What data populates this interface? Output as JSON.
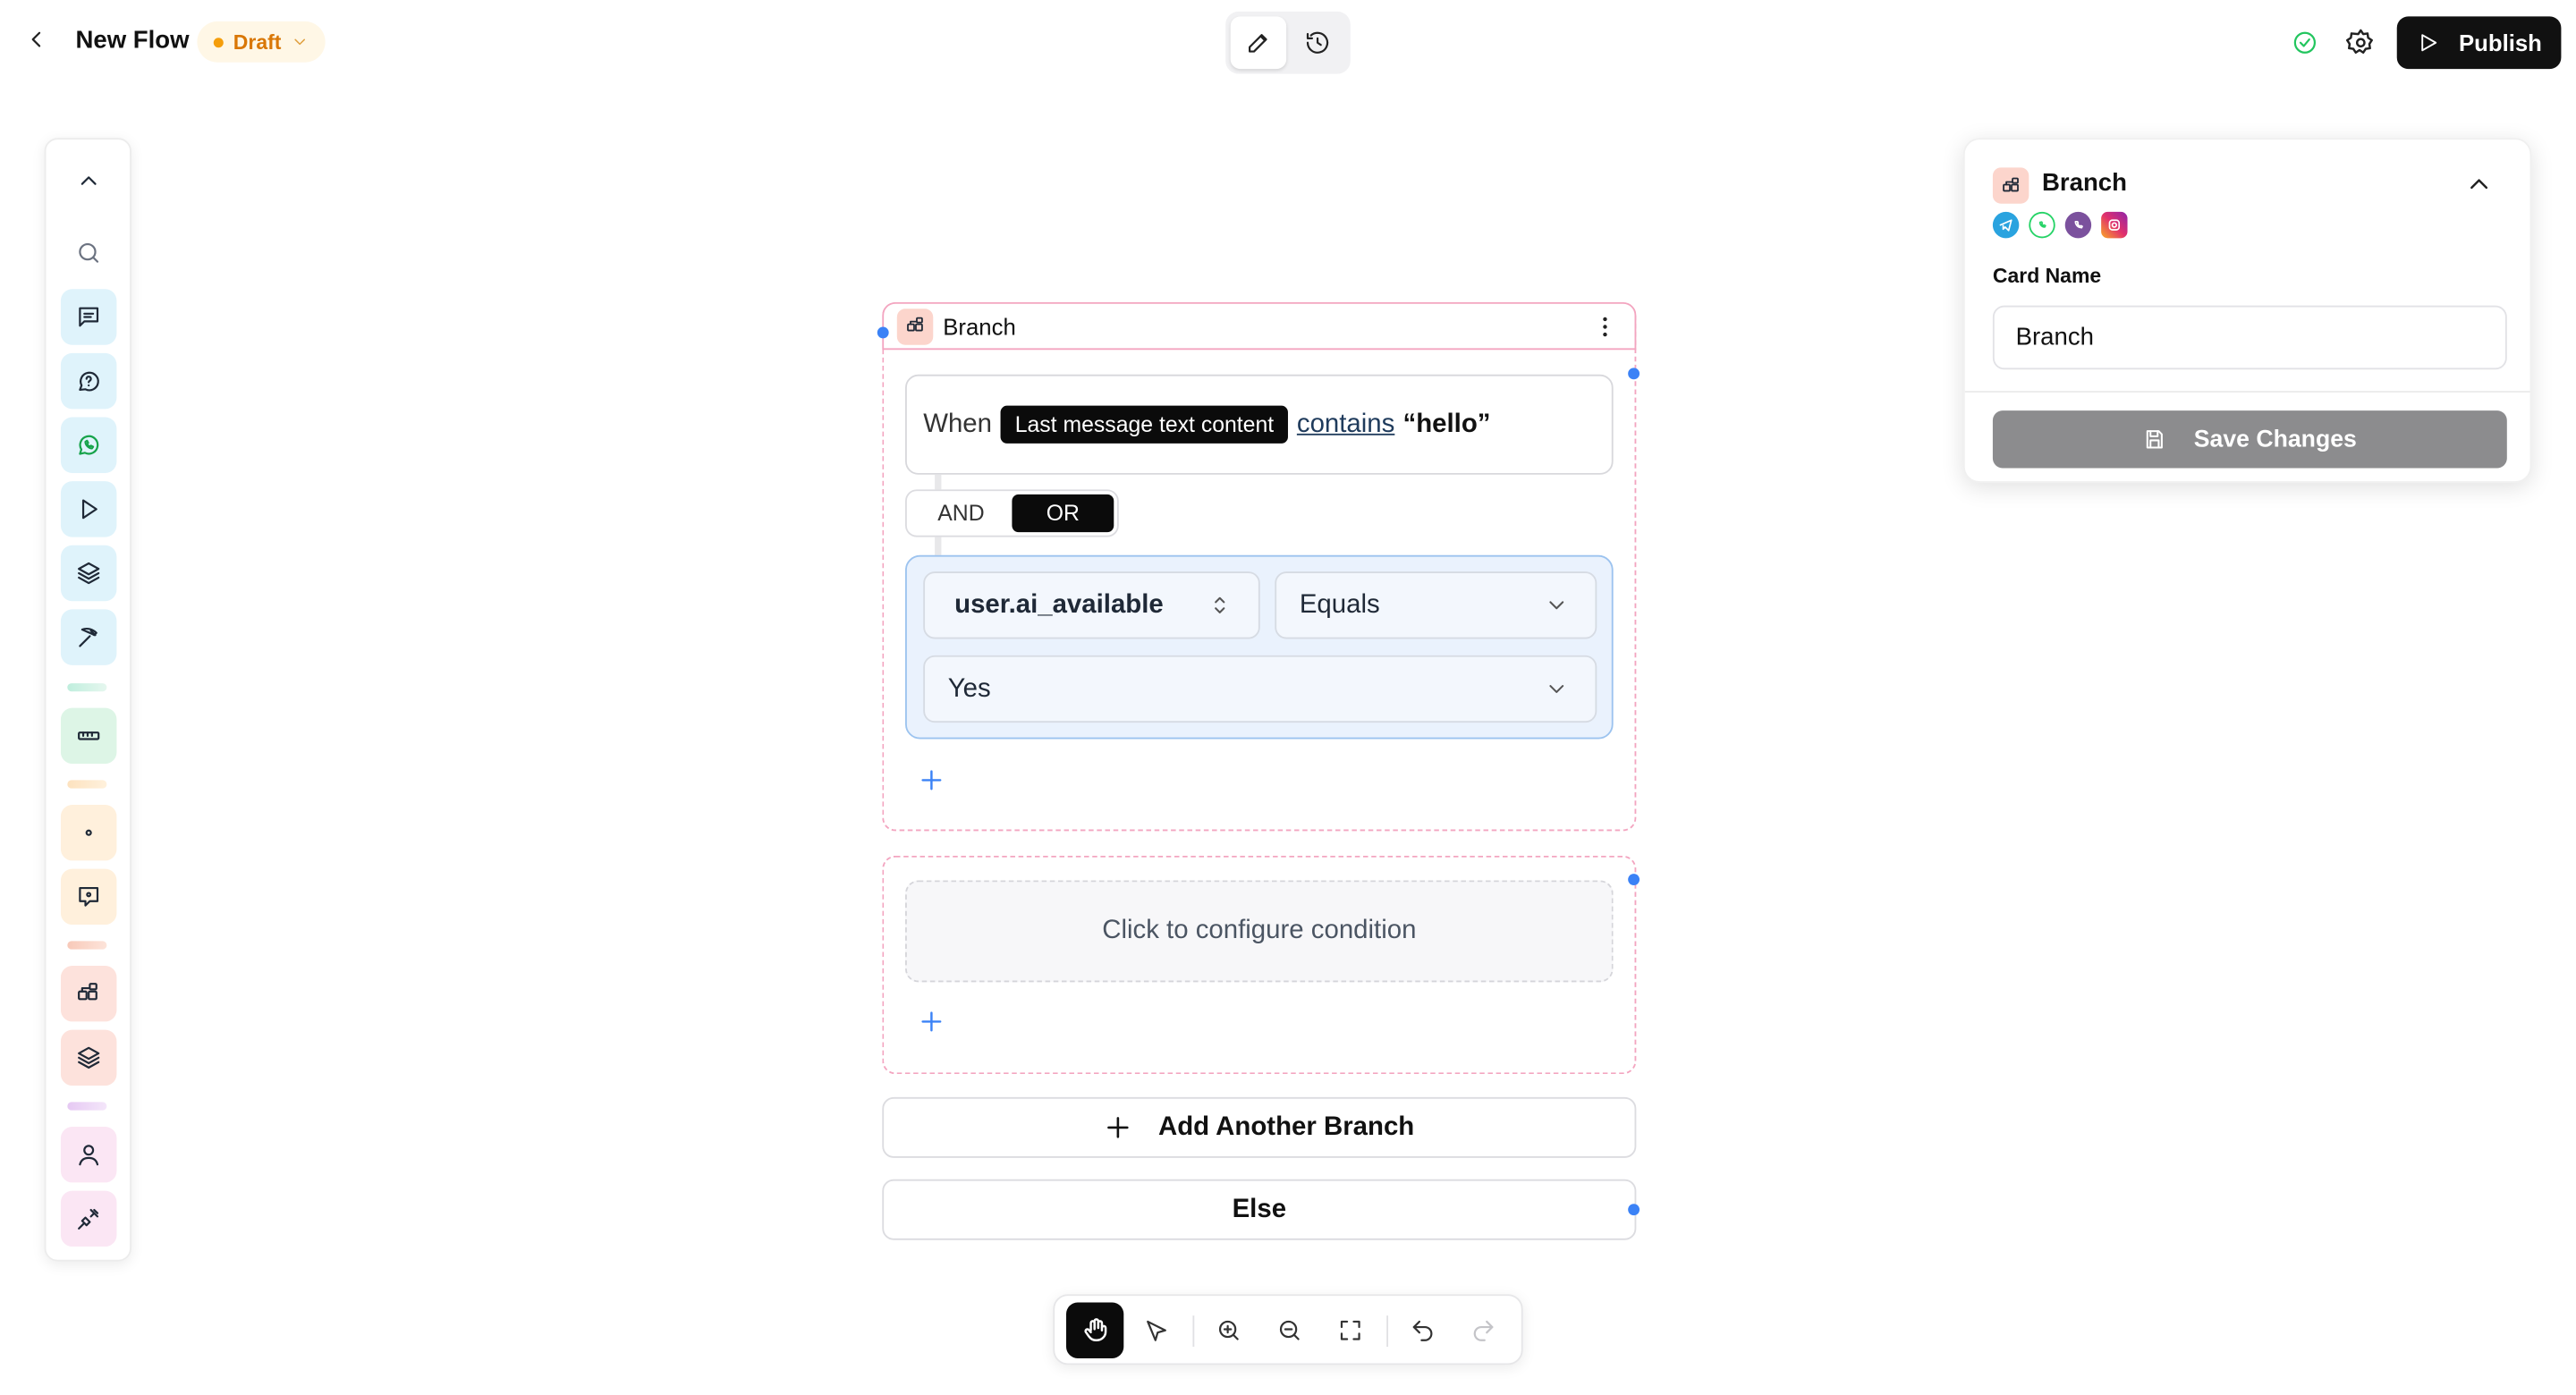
{
  "topbar": {
    "flow_name": "New Flow",
    "status": "Draft",
    "publish_label": "Publish"
  },
  "node": {
    "title": "Branch",
    "condition": {
      "prefix": "When",
      "variable": "Last message text content",
      "operator": "contains",
      "value": "“hello”"
    },
    "logic": {
      "and_label": "AND",
      "or_label": "OR",
      "selected": "OR"
    },
    "rule": {
      "variable": "user.ai_available",
      "operator": "Equals",
      "value": "Yes"
    },
    "empty_condition_label": "Click to configure condition",
    "add_branch_label": "Add Another Branch",
    "else_label": "Else"
  },
  "panel": {
    "title": "Branch",
    "channels": [
      "telegram-icon",
      "whatsapp-icon",
      "viber-icon",
      "instagram-icon"
    ],
    "card_name_label": "Card Name",
    "card_name_value": "Branch",
    "save_label": "Save Changes"
  },
  "toolbar": {
    "items": [
      "search-icon",
      "message-icon",
      "question-message-icon",
      "whatsapp-icon",
      "play-icon",
      "layers-icon",
      "pickaxe-icon",
      "ruler-icon",
      "dot-icon",
      "chat-bubble-icon",
      "branch-icon",
      "layers-icon",
      "user-icon",
      "plug-icon"
    ]
  },
  "colors": {
    "accent_blue": "#3b82f6",
    "branch_pink": "#f3a5c0",
    "draft_orange": "#d97706",
    "publish_black": "#111111"
  }
}
